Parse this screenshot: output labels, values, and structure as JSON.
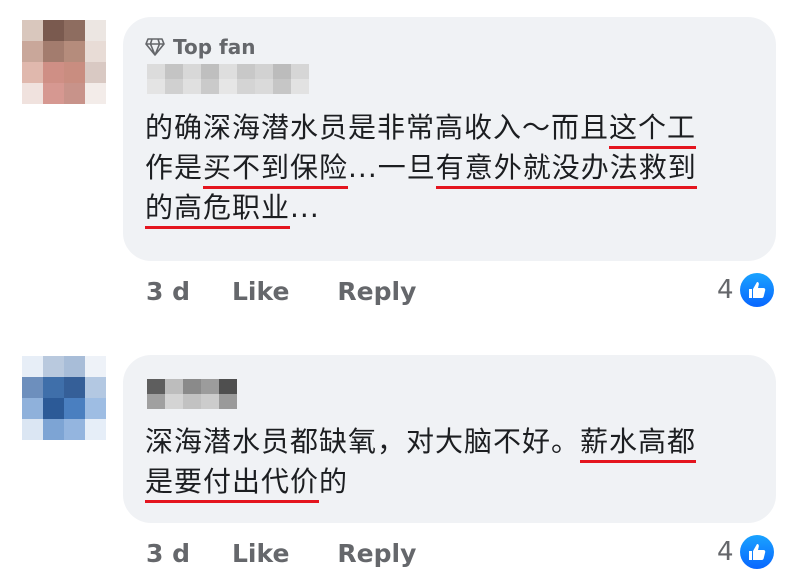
{
  "comments": [
    {
      "badge_label": "Top fan",
      "badge_icon": "diamond-icon",
      "lines": [
        [
          {
            "t": "的确深海潜水员是非常高收入～而且"
          },
          {
            "t": "这个工",
            "u": true
          }
        ],
        [
          {
            "t": "作是"
          },
          {
            "t": "买不到保险",
            "u": true
          },
          {
            "t": "...一旦"
          },
          {
            "t": "有意外就没办法救到",
            "u": true
          }
        ],
        [
          {
            "t": "的高危职业",
            "u": true
          },
          {
            "t": "..."
          }
        ]
      ],
      "age": "3 d",
      "like_label": "Like",
      "reply_label": "Reply",
      "reaction_count": "4",
      "reaction_icon": "thumbs-up-icon"
    },
    {
      "lines": [
        [
          {
            "t": "深海潜水员都缺氧，对大脑不好。"
          },
          {
            "t": "薪水高都",
            "u": true
          }
        ],
        [
          {
            "t": "是要付出代价",
            "u": true
          },
          {
            "t": "的"
          }
        ]
      ],
      "age": "3 d",
      "like_label": "Like",
      "reply_label": "Reply",
      "reaction_count": "4",
      "reaction_icon": "thumbs-up-icon"
    }
  ],
  "colors": {
    "underline": "#e4151f",
    "bubble": "#f0f2f5",
    "meta_text": "#65676b",
    "like_blue": "#0866ff"
  }
}
